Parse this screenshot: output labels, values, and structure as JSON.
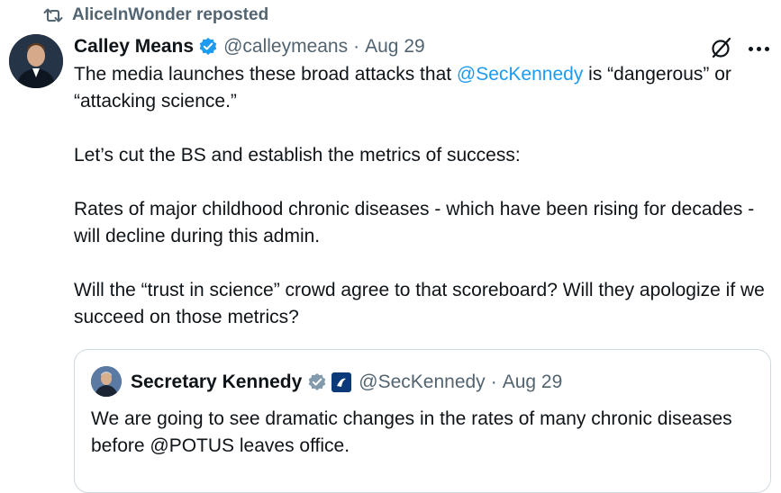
{
  "repost": {
    "label": "AliceInWonder reposted",
    "icon": "repost-icon"
  },
  "tweet": {
    "author_name": "Calley Means",
    "handle": "@calleymeans",
    "separator": "·",
    "date": "Aug 29",
    "line1_before": "The media launches these broad attacks that ",
    "mention": "@SecKennedy",
    "line1_after": " is “dangerous” or “attacking science.”",
    "para2": "Let’s cut the BS and establish the metrics of success:",
    "para3": "Rates of major childhood chronic diseases - which have been rising for decades - will decline during this admin.",
    "para4": "Will the “trust in science” crowd agree to that scoreboard? Will they apologize if we succeed on those metrics?"
  },
  "quote": {
    "author_name": "Secretary Kennedy",
    "handle": "@SecKennedy",
    "separator": "·",
    "date": "Aug 29",
    "text": "We are going to see dramatic changes in the rates of many chronic diseases before @POTUS leaves office."
  },
  "colors": {
    "accent": "#1d9bf0",
    "muted": "#536471",
    "text": "#0f1419",
    "border": "#cfd9de"
  }
}
